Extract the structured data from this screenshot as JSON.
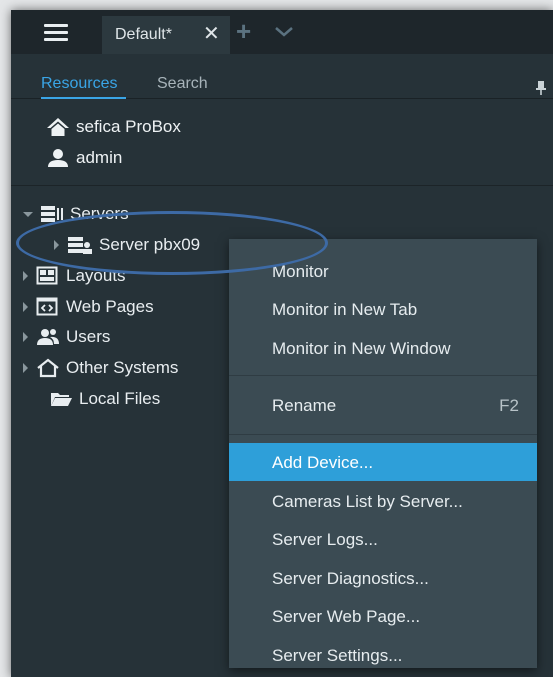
{
  "tab_bar": {
    "tab_label": "Default*",
    "close_glyph": "✕",
    "add_glyph": "+"
  },
  "panel_tabs": {
    "resources": "Resources",
    "search": "Search"
  },
  "system": {
    "name": "sefica ProBox",
    "user": "admin"
  },
  "tree": {
    "servers": "Servers",
    "server_item": "Server pbx09",
    "layouts": "Layouts",
    "web_pages": "Web Pages",
    "users": "Users",
    "other_systems": "Other Systems",
    "local_files": "Local Files"
  },
  "context_menu": {
    "monitor": "Monitor",
    "monitor_new_tab": "Monitor in New Tab",
    "monitor_new_window": "Monitor in New Window",
    "rename": "Rename",
    "rename_shortcut": "F2",
    "add_device": "Add Device...",
    "cameras_list": "Cameras List by Server...",
    "server_logs": "Server Logs...",
    "server_diagnostics": "Server Diagnostics...",
    "server_web_page": "Server Web Page...",
    "server_settings": "Server Settings..."
  },
  "colors": {
    "accent": "#3aa5e6",
    "menu_highlight": "#2e9fd9",
    "panel_bg": "#263238",
    "menu_bg": "#3b4b53",
    "annotation_ellipse": "#3d6aa5"
  },
  "icons": {
    "menu": "hamburger-icon",
    "pin": "pin-icon",
    "home": "home-icon",
    "user": "user-icon",
    "servers": "servers-icon",
    "server": "server-icon",
    "layouts": "layouts-icon",
    "web_pages": "web-pages-icon",
    "users": "users-icon",
    "other_systems": "other-systems-icon",
    "local_files": "folder-icon"
  }
}
